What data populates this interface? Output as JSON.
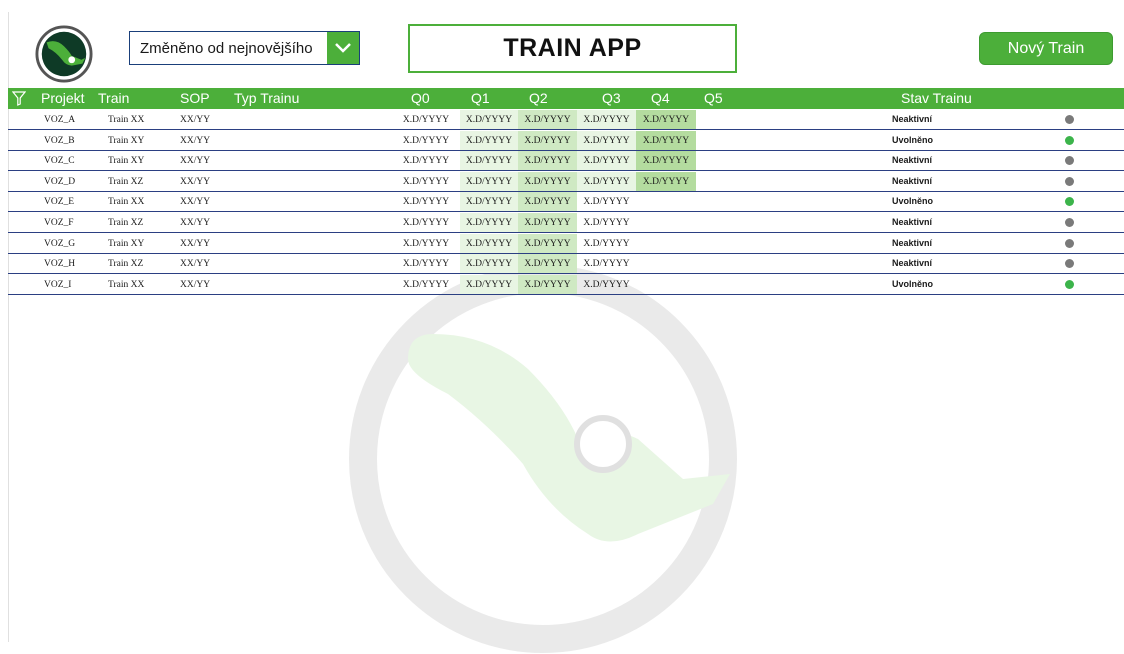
{
  "header": {
    "sort_value": "Změněno od nejnovějšího",
    "title": "TRAIN APP",
    "new_button": "Nový Train"
  },
  "colors": {
    "accent": "#4caf3a",
    "row_border": "#2b3f82",
    "q_light": "#e8f5e3",
    "q_mid": "#cfe9c3",
    "q_dark": "#b4dc9f",
    "status_active": "#3cb44b",
    "status_inactive": "#7a7a7a"
  },
  "columns": {
    "projekt": "Projekt",
    "train": "Train",
    "sop": "SOP",
    "typ": "Typ Trainu",
    "q0": "Q0",
    "q1": "Q1",
    "q2": "Q2",
    "q3": "Q3",
    "q4": "Q4",
    "q5": "Q5",
    "stav": "Stav Trainu"
  },
  "rows": [
    {
      "projekt": "VOZ_A",
      "train": "Train XX",
      "sop": "XX/YY",
      "q0": "X.D/YYYY",
      "q1": "X.D/YYYY",
      "q2": "X.D/YYYY",
      "q3": "X.D/YYYY",
      "q4": "X.D/YYYY",
      "stav": "Neaktivní",
      "active": false
    },
    {
      "projekt": "VOZ_B",
      "train": "Train XY",
      "sop": "XX/YY",
      "q0": "X.D/YYYY",
      "q1": "X.D/YYYY",
      "q2": "X.D/YYYY",
      "q3": "X.D/YYYY",
      "q4": "X.D/YYYY",
      "stav": "Uvolněno",
      "active": true
    },
    {
      "projekt": "VOZ_C",
      "train": "Train XY",
      "sop": "XX/YY",
      "q0": "X.D/YYYY",
      "q1": "X.D/YYYY",
      "q2": "X.D/YYYY",
      "q3": "X.D/YYYY",
      "q4": "X.D/YYYY",
      "stav": "Neaktivní",
      "active": false
    },
    {
      "projekt": "VOZ_D",
      "train": "Train XZ",
      "sop": "XX/YY",
      "q0": "X.D/YYYY",
      "q1": "X.D/YYYY",
      "q2": "X.D/YYYY",
      "q3": "X.D/YYYY",
      "q4": "X.D/YYYY",
      "stav": "Neaktivní",
      "active": false
    },
    {
      "projekt": "VOZ_E",
      "train": "Train XX",
      "sop": "XX/YY",
      "q0": "X.D/YYYY",
      "q1": "X.D/YYYY",
      "q2": "X.D/YYYY",
      "q3": "X.D/YYYY",
      "q4": "",
      "stav": "Uvolněno",
      "active": true
    },
    {
      "projekt": "VOZ_F",
      "train": "Train XZ",
      "sop": "XX/YY",
      "q0": "X.D/YYYY",
      "q1": "X.D/YYYY",
      "q2": "X.D/YYYY",
      "q3": "X.D/YYYY",
      "q4": "",
      "stav": "Neaktivní",
      "active": false
    },
    {
      "projekt": "VOZ_G",
      "train": "Train XY",
      "sop": "XX/YY",
      "q0": "X.D/YYYY",
      "q1": "X.D/YYYY",
      "q2": "X.D/YYYY",
      "q3": "X.D/YYYY",
      "q4": "",
      "stav": "Neaktivní",
      "active": false
    },
    {
      "projekt": "VOZ_H",
      "train": "Train XZ",
      "sop": "XX/YY",
      "q0": "X.D/YYYY",
      "q1": "X.D/YYYY",
      "q2": "X.D/YYYY",
      "q3": "X.D/YYYY",
      "q4": "",
      "stav": "Neaktivní",
      "active": false
    },
    {
      "projekt": "VOZ_I",
      "train": "Train XX",
      "sop": "XX/YY",
      "q0": "X.D/YYYY",
      "q1": "X.D/YYYY",
      "q2": "X.D/YYYY",
      "q3": "X.D/YYYY",
      "q4": "",
      "stav": "Uvolněno",
      "active": true
    }
  ]
}
